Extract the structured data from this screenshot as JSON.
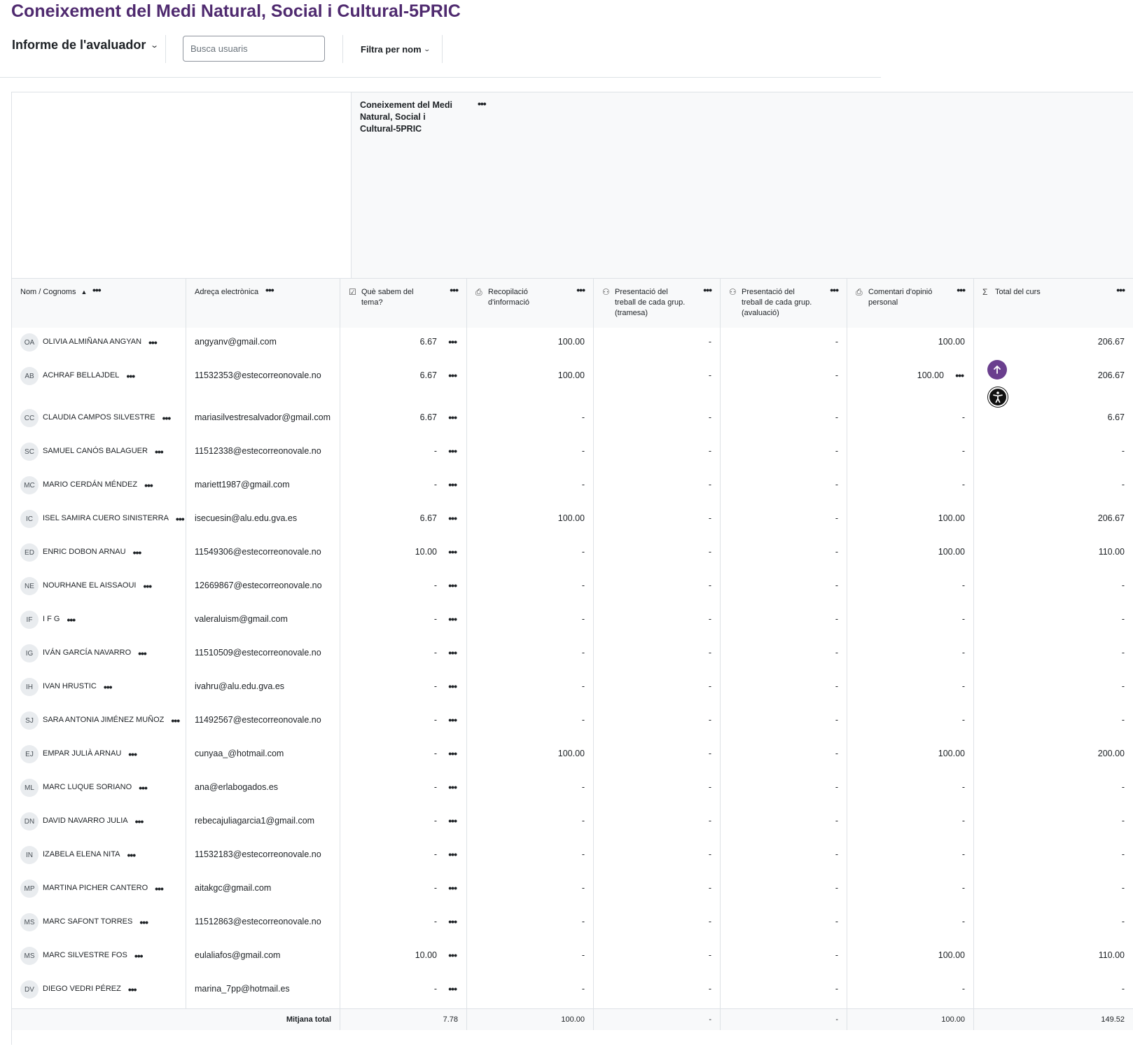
{
  "page": {
    "title": "Coneixement del Medi Natural, Social i Cultural-5PRIC"
  },
  "toolbar": {
    "report_label": "Informe de l'avaluador",
    "search_placeholder": "Busca usuaris",
    "filter_label": "Filtra per nom"
  },
  "category": {
    "title": "Coneixement del Medi Natural, Social i Cultural-5PRIC"
  },
  "columns": {
    "name": "Nom / Cognoms",
    "email": "Adreça electrònica",
    "items": [
      {
        "label": "Què sabem del tema?",
        "icon": "quiz-icon"
      },
      {
        "label": "Recopilació d'informació",
        "icon": "assignment-icon"
      },
      {
        "label": "Presentació del treball de cada grup. (tramesa)",
        "icon": "workshop-icon"
      },
      {
        "label": "Presentació del treball de cada grup. (avaluació)",
        "icon": "workshop-icon"
      },
      {
        "label": "Comentari d'opinió personal",
        "icon": "assignment-icon"
      },
      {
        "label": "Total del curs",
        "icon": "sigma-icon"
      }
    ]
  },
  "students": [
    {
      "initials": "OA",
      "name": "OLIVIA ALMIÑANA ANGYAN",
      "email": "angyanv@gmail.com",
      "grades": [
        "6.67",
        "100.00",
        "-",
        "-",
        "100.00",
        "206.67"
      ]
    },
    {
      "initials": "AB",
      "name": "ACHRAF BELLAJDEL",
      "email": "11532353@estecorreonovale.no",
      "grades": [
        "6.67",
        "100.00",
        "-",
        "-",
        "100.00",
        "206.67"
      ]
    },
    {
      "initials": "CC",
      "name": "CLAUDIA CAMPOS SILVESTRE",
      "email": "mariasilvestresalvador@gmail.com",
      "grades": [
        "6.67",
        "-",
        "-",
        "-",
        "-",
        "6.67"
      ]
    },
    {
      "initials": "SC",
      "name": "SAMUEL CANÓS BALAGUER",
      "email": "11512338@estecorreonovale.no",
      "grades": [
        "-",
        "-",
        "-",
        "-",
        "-",
        "-"
      ]
    },
    {
      "initials": "MC",
      "name": "MARIO CERDÁN MÉNDEZ",
      "email": "mariett1987@gmail.com",
      "grades": [
        "-",
        "-",
        "-",
        "-",
        "-",
        "-"
      ]
    },
    {
      "initials": "IC",
      "name": "ISEL SAMIRA CUERO SINISTERRA",
      "email": "isecuesin@alu.edu.gva.es",
      "grades": [
        "6.67",
        "100.00",
        "-",
        "-",
        "100.00",
        "206.67"
      ]
    },
    {
      "initials": "ED",
      "name": "ENRIC DOBON ARNAU",
      "email": "11549306@estecorreonovale.no",
      "grades": [
        "10.00",
        "-",
        "-",
        "-",
        "100.00",
        "110.00"
      ]
    },
    {
      "initials": "NE",
      "name": "NOURHANE EL AISSAOUI",
      "email": "12669867@estecorreonovale.no",
      "grades": [
        "-",
        "-",
        "-",
        "-",
        "-",
        "-"
      ]
    },
    {
      "initials": "IF",
      "name": "I F G",
      "email": "valeraluism@gmail.com",
      "grades": [
        "-",
        "-",
        "-",
        "-",
        "-",
        "-"
      ]
    },
    {
      "initials": "IG",
      "name": "IVÁN GARCÍA NAVARRO",
      "email": "11510509@estecorreonovale.no",
      "grades": [
        "-",
        "-",
        "-",
        "-",
        "-",
        "-"
      ]
    },
    {
      "initials": "IH",
      "name": "IVAN HRUSTIC",
      "email": "ivahru@alu.edu.gva.es",
      "grades": [
        "-",
        "-",
        "-",
        "-",
        "-",
        "-"
      ]
    },
    {
      "initials": "SJ",
      "name": "SARA ANTONIA JIMÉNEZ MUÑOZ",
      "email": "11492567@estecorreonovale.no",
      "grades": [
        "-",
        "-",
        "-",
        "-",
        "-",
        "-"
      ]
    },
    {
      "initials": "EJ",
      "name": "EMPAR JULIÀ ARNAU",
      "email": "cunyaa_@hotmail.com",
      "grades": [
        "-",
        "100.00",
        "-",
        "-",
        "100.00",
        "200.00"
      ]
    },
    {
      "initials": "ML",
      "name": "MARC LUQUE SORIANO",
      "email": "ana@erlabogados.es",
      "grades": [
        "-",
        "-",
        "-",
        "-",
        "-",
        "-"
      ]
    },
    {
      "initials": "DN",
      "name": "DAVID NAVARRO JULIA",
      "email": "rebecajuliagarcia1@gmail.com",
      "grades": [
        "-",
        "-",
        "-",
        "-",
        "-",
        "-"
      ]
    },
    {
      "initials": "IN",
      "name": "IZABELA ELENA NITA",
      "email": "11532183@estecorreonovale.no",
      "grades": [
        "-",
        "-",
        "-",
        "-",
        "-",
        "-"
      ]
    },
    {
      "initials": "MP",
      "name": "MARTINA PICHER CANTERO",
      "email": "aitakgc@gmail.com",
      "grades": [
        "-",
        "-",
        "-",
        "-",
        "-",
        "-"
      ]
    },
    {
      "initials": "MS",
      "name": "MARC SAFONT TORRES",
      "email": "11512863@estecorreonovale.no",
      "grades": [
        "-",
        "-",
        "-",
        "-",
        "-",
        "-"
      ]
    },
    {
      "initials": "MS",
      "name": "MARC SILVESTRE FOS",
      "email": "eulaliafos@gmail.com",
      "grades": [
        "10.00",
        "-",
        "-",
        "-",
        "100.00",
        "110.00"
      ]
    },
    {
      "initials": "DV",
      "name": "DIEGO VEDRI PÉREZ",
      "email": "marina_7pp@hotmail.es",
      "grades": [
        "-",
        "-",
        "-",
        "-",
        "-",
        "-"
      ]
    }
  ],
  "footer": {
    "label": "Mitjana total",
    "values": [
      "7.78",
      "100.00",
      "-",
      "-",
      "100.00",
      "149.52"
    ]
  },
  "colors": {
    "accent": "#4f2a6f",
    "fab": "#6a3f8e"
  }
}
